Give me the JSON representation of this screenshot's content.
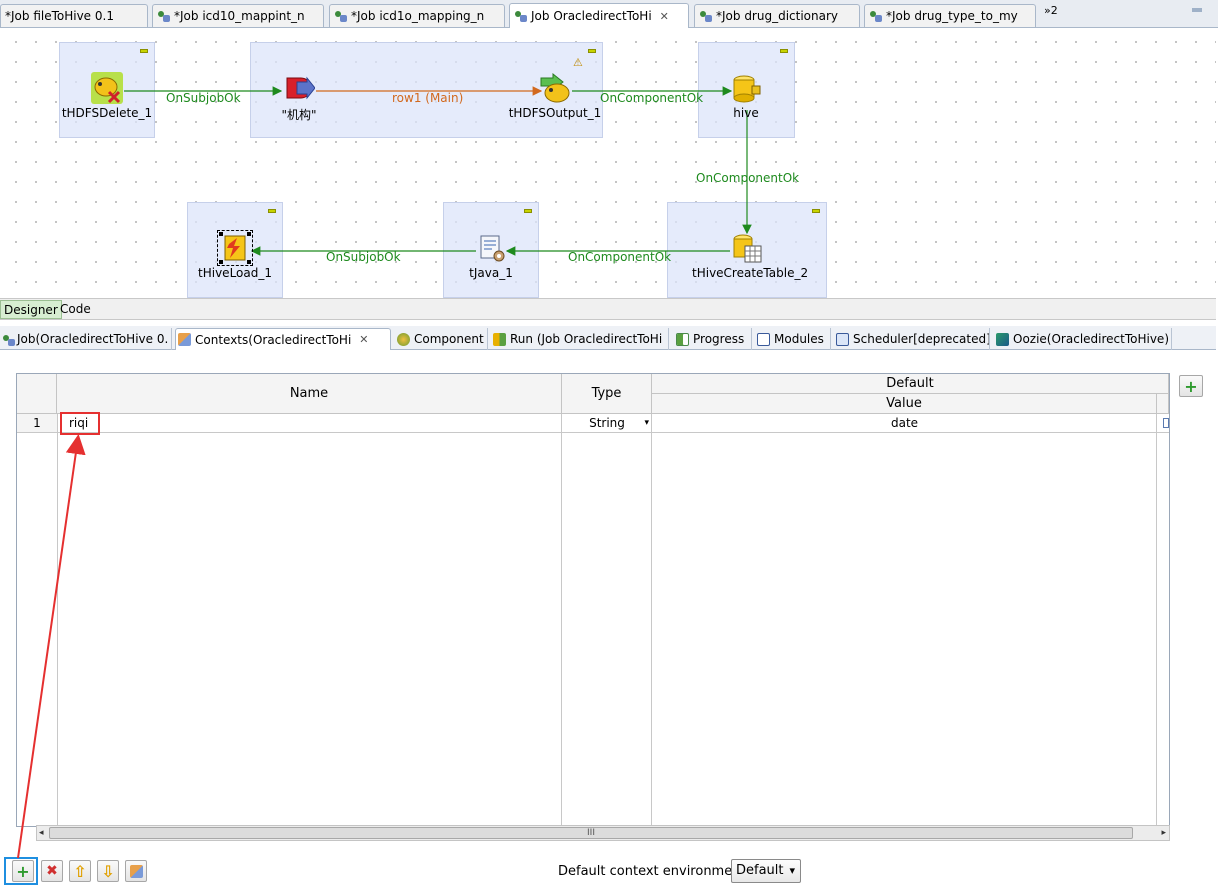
{
  "editor_tabs": [
    {
      "label": "*Job fileToHive 0.1"
    },
    {
      "label": "*Job icd10_mappint_n"
    },
    {
      "label": "*Job icd1o_mapping_n"
    },
    {
      "label": "Job OracledirectToHi"
    },
    {
      "label": "*Job drug_dictionary"
    },
    {
      "label": "*Job drug_type_to_my"
    }
  ],
  "editor_tabs_overflow": "»2",
  "close_glyph": "✕",
  "designer": {
    "components": [
      {
        "label": "tHDFSDelete_1"
      },
      {
        "label": "\"机构\""
      },
      {
        "label": "tHDFSOutput_1"
      },
      {
        "label": "hive"
      },
      {
        "label": "tHiveLoad_1"
      },
      {
        "label": "tJava_1"
      },
      {
        "label": "tHiveCreateTable_2"
      }
    ],
    "links": [
      {
        "label": "OnSubjobOk"
      },
      {
        "label": "row1 (Main)"
      },
      {
        "label": "OnComponentOk"
      },
      {
        "label": "OnComponentOk"
      },
      {
        "label": "OnSubjobOk"
      },
      {
        "label": "OnComponentOk"
      }
    ],
    "warning_glyph": "⚠"
  },
  "designer_tabs": [
    {
      "label": "Designer"
    },
    {
      "label": "Code"
    }
  ],
  "view_tabs": [
    {
      "label": "Job(OracledirectToHive 0."
    },
    {
      "label": "Contexts(OracledirectToHi"
    },
    {
      "label": "Component"
    },
    {
      "label": "Run (Job OracledirectToHi"
    },
    {
      "label": "Progress"
    },
    {
      "label": "Modules"
    },
    {
      "label": "Scheduler[deprecated]"
    },
    {
      "label": "Oozie(OracledirectToHive)"
    }
  ],
  "context_table": {
    "headers": {
      "name": "Name",
      "type": "Type",
      "default": "Default",
      "value": "Value"
    },
    "rows": [
      {
        "index": "1",
        "name": "riqi",
        "type": "String",
        "value": "date"
      }
    ],
    "scroll_grip": "III"
  },
  "toolbar": {
    "add_glyph": "+",
    "remove_glyph": "✖",
    "up_glyph": "⇧",
    "down_glyph": "⇩",
    "env_label": "Default context environment",
    "env_value": "Default"
  },
  "colors": {
    "highlight_red": "#e53030",
    "highlight_blue": "#1f8fe0",
    "link_green": "#1e8a1e",
    "link_orange": "#d2691e"
  }
}
